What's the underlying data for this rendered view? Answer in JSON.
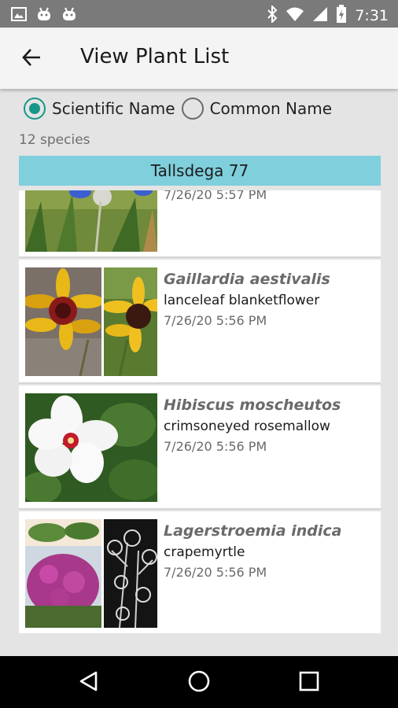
{
  "status_bar": {
    "time": "7:31",
    "left_icons": [
      "image-icon",
      "android-icon",
      "android-icon"
    ],
    "right_icons": [
      "bluetooth-icon",
      "wifi-icon",
      "signal-icon",
      "battery-charging-icon"
    ]
  },
  "app_bar": {
    "title": "View Plant List",
    "back_icon": "arrow-left-icon"
  },
  "name_toggle": {
    "options": [
      {
        "label": "Scientific Name",
        "selected": true
      },
      {
        "label": "Common Name",
        "selected": false
      }
    ]
  },
  "species_count": "12 species",
  "site_header": "Tallsdega 77",
  "plants": [
    {
      "scientific": "",
      "common": "",
      "date": "7/26/20 5:57 PM"
    },
    {
      "scientific": "Gaillardia aestivalis",
      "common": "lanceleaf blanketflower",
      "date": "7/26/20 5:56 PM"
    },
    {
      "scientific": "Hibiscus moscheutos",
      "common": "crimsoneyed rosemallow",
      "date": "7/26/20 5:56 PM"
    },
    {
      "scientific": "Lagerstroemia indica",
      "common": "crapemyrtle",
      "date": "7/26/20 5:56 PM"
    }
  ],
  "colors": {
    "accent": "#16978a",
    "header_bar": "#7fcfdc",
    "status_bar": "#7a7a7a",
    "nav_bar": "#000000"
  },
  "nav_bar": {
    "icons": [
      "back-triangle-icon",
      "home-circle-icon",
      "recents-square-icon"
    ]
  }
}
